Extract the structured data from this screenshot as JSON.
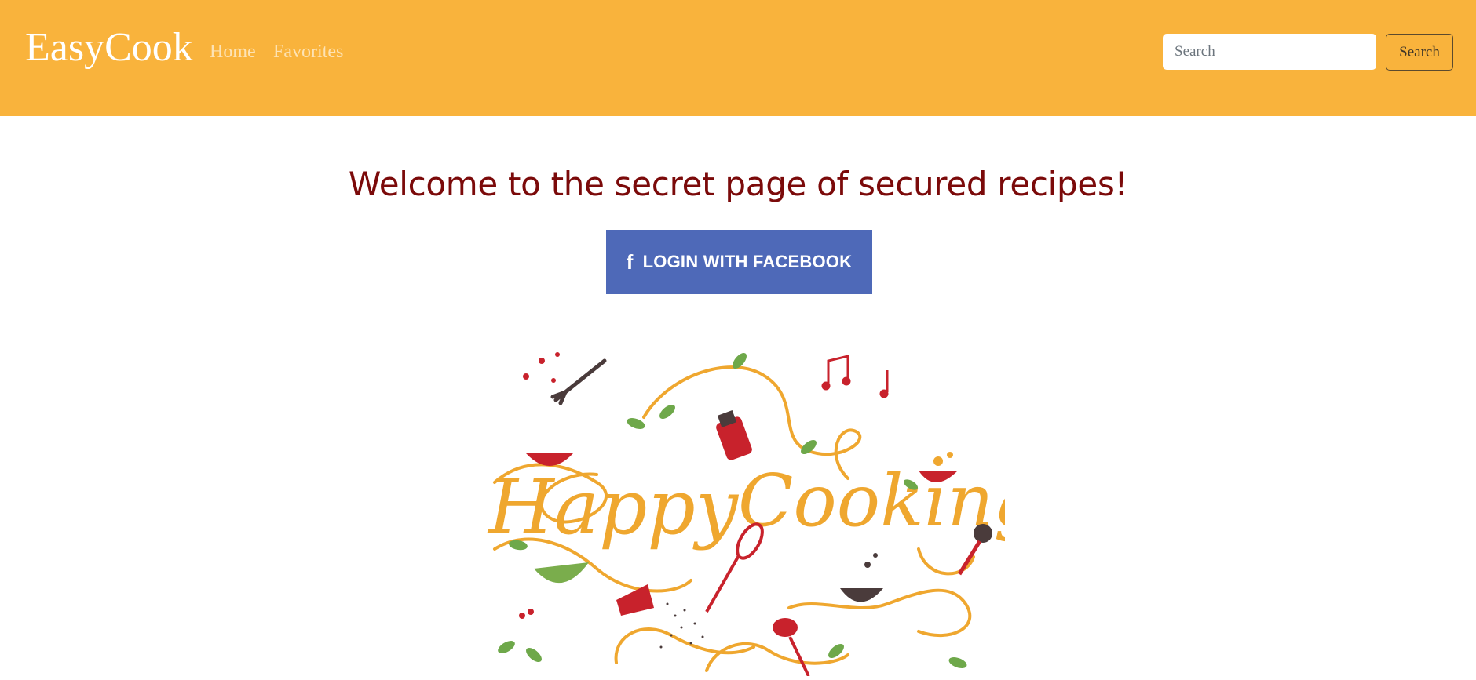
{
  "navbar": {
    "brand": "EasyCook",
    "links": [
      "Home",
      "Favorites"
    ],
    "search": {
      "placeholder": "Search",
      "value": "",
      "button_label": "Search"
    },
    "background_color": "#f9b33c"
  },
  "main": {
    "heading": "Welcome to the secret page of secured recipes!",
    "heading_color": "#7b0a0a",
    "facebook_login": {
      "icon": "facebook-f-icon",
      "icon_glyph": "f",
      "label": "LOGIN WITH FACEBOOK",
      "color": "#4e69b8"
    },
    "illustration": {
      "text": "Happy Cooking",
      "accent_color": "#efa72f"
    }
  }
}
